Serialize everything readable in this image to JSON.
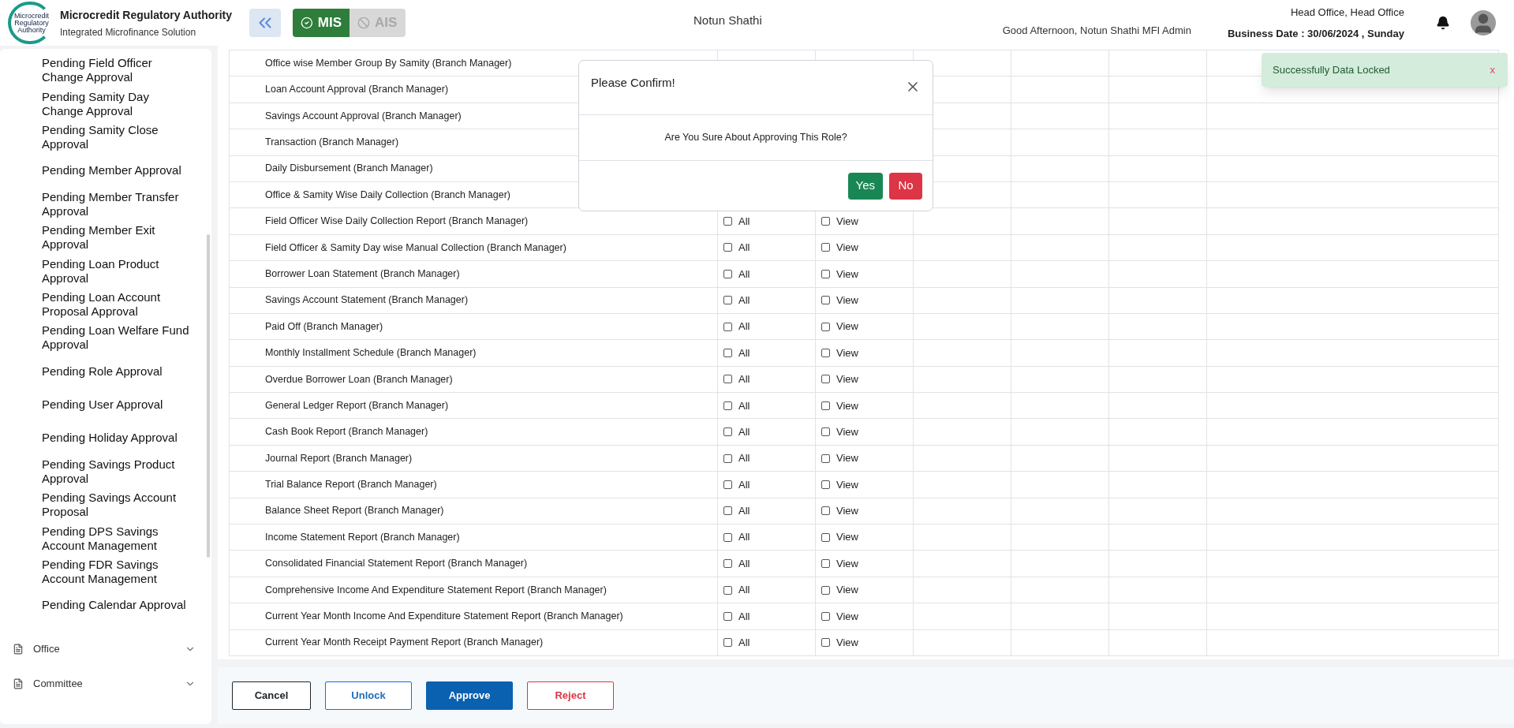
{
  "header": {
    "logo_caption": "Microcredit Regulatory Authority",
    "title": "Microcredit Regulatory Authority",
    "subtitle": "Integrated Microfinance Solution",
    "modes": [
      {
        "label": "MIS",
        "selected": true
      },
      {
        "label": "AIS",
        "selected": false
      }
    ],
    "organization": "Notun Shathi",
    "greeting": "Good Afternoon, Notun Shathi MFI Admin",
    "office": "Head Office, Head Office",
    "business_date": "Business Date : 30/06/2024 , Sunday"
  },
  "sidebar": {
    "items": [
      "Pending Field Officer Change Approval",
      "Pending Samity Day Change Approval",
      "Pending Samity Close Approval",
      "Pending Member Approval",
      "Pending Member Transfer Approval",
      "Pending Member Exit Approval",
      "Pending Loan Product Approval",
      "Pending Loan Account Proposal Approval",
      "Pending Loan Welfare Fund Approval",
      "Pending Role Approval",
      "Pending User Approval",
      "Pending Holiday Approval",
      "Pending Savings Product Approval",
      "Pending Savings Account Proposal",
      "Pending DPS Savings Account Management",
      "Pending FDR Savings Account Management",
      "Pending Calendar Approval"
    ],
    "groups": [
      {
        "label": "Office",
        "expanded": false
      },
      {
        "label": "Committee",
        "expanded": false
      }
    ]
  },
  "table": {
    "rows": [
      {
        "name": "Office wise Member Group By Samity (Branch Manager)"
      },
      {
        "name": "Loan Account Approval (Branch Manager)"
      },
      {
        "name": "Savings Account Approval (Branch Manager)"
      },
      {
        "name": "Transaction (Branch Manager)"
      },
      {
        "name": "Daily Disbursement (Branch Manager)"
      },
      {
        "name": "Office & Samity Wise Daily Collection (Branch Manager)"
      },
      {
        "name": "Field Officer Wise Daily Collection Report (Branch Manager)",
        "all": {
          "label": "All",
          "checked": false
        },
        "view": {
          "label": "View",
          "checked": false
        }
      },
      {
        "name": "Field Officer & Samity Day wise Manual Collection (Branch Manager)",
        "all": {
          "label": "All",
          "checked": false
        },
        "view": {
          "label": "View",
          "checked": false
        }
      },
      {
        "name": "Borrower Loan Statement (Branch Manager)",
        "all": {
          "label": "All",
          "checked": false
        },
        "view": {
          "label": "View",
          "checked": false
        }
      },
      {
        "name": "Savings Account Statement (Branch Manager)",
        "all": {
          "label": "All",
          "checked": false
        },
        "view": {
          "label": "View",
          "checked": false
        }
      },
      {
        "name": "Paid Off (Branch Manager)",
        "all": {
          "label": "All",
          "checked": false
        },
        "view": {
          "label": "View",
          "checked": false
        }
      },
      {
        "name": "Monthly Installment Schedule (Branch Manager)",
        "all": {
          "label": "All",
          "checked": false
        },
        "view": {
          "label": "View",
          "checked": false
        }
      },
      {
        "name": "Overdue Borrower Loan (Branch Manager)",
        "all": {
          "label": "All",
          "checked": false
        },
        "view": {
          "label": "View",
          "checked": false
        }
      },
      {
        "name": "General Ledger Report (Branch Manager)",
        "all": {
          "label": "All",
          "checked": false
        },
        "view": {
          "label": "View",
          "checked": false
        }
      },
      {
        "name": "Cash Book Report (Branch Manager)",
        "all": {
          "label": "All",
          "checked": false
        },
        "view": {
          "label": "View",
          "checked": false
        }
      },
      {
        "name": "Journal Report (Branch Manager)",
        "all": {
          "label": "All",
          "checked": false
        },
        "view": {
          "label": "View",
          "checked": false
        }
      },
      {
        "name": "Trial Balance Report (Branch Manager)",
        "all": {
          "label": "All",
          "checked": false
        },
        "view": {
          "label": "View",
          "checked": false
        }
      },
      {
        "name": "Balance Sheet Report (Branch Manager)",
        "all": {
          "label": "All",
          "checked": false
        },
        "view": {
          "label": "View",
          "checked": false
        }
      },
      {
        "name": "Income Statement Report (Branch Manager)",
        "all": {
          "label": "All",
          "checked": false
        },
        "view": {
          "label": "View",
          "checked": false
        }
      },
      {
        "name": "Consolidated Financial Statement Report (Branch Manager)",
        "all": {
          "label": "All",
          "checked": false
        },
        "view": {
          "label": "View",
          "checked": false
        }
      },
      {
        "name": "Comprehensive Income And Expenditure Statement Report (Branch Manager)",
        "all": {
          "label": "All",
          "checked": false
        },
        "view": {
          "label": "View",
          "checked": false
        }
      },
      {
        "name": "Current Year Month Income And Expenditure Statement Report (Branch Manager)",
        "all": {
          "label": "All",
          "checked": false
        },
        "view": {
          "label": "View",
          "checked": false
        }
      },
      {
        "name": "Current Year Month Receipt Payment Report (Branch Manager)",
        "all": {
          "label": "All",
          "checked": false
        },
        "view": {
          "label": "View",
          "checked": false
        }
      }
    ]
  },
  "actions": [
    {
      "label": "Cancel",
      "kind": "outline-dark"
    },
    {
      "label": "Unlock",
      "kind": "outline-primary"
    },
    {
      "label": "Approve",
      "kind": "primary"
    },
    {
      "label": "Reject",
      "kind": "outline-danger"
    }
  ],
  "dialog": {
    "title": "Please Confirm!",
    "message": "Are You Sure About Approving This Role?",
    "buttons": [
      {
        "label": "Yes",
        "kind": "success"
      },
      {
        "label": "No",
        "kind": "danger"
      }
    ]
  },
  "toast": {
    "message": "Successfully Data Locked",
    "close": "x"
  }
}
